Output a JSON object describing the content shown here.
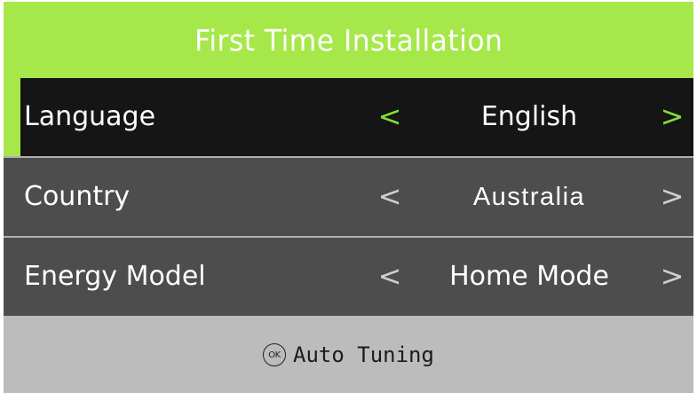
{
  "header": {
    "title": "First Time Installation"
  },
  "rows": [
    {
      "label": "Language",
      "value": "English",
      "left_arrow": "<",
      "right_arrow": ">",
      "focused": true
    },
    {
      "label": "Country",
      "value": "Australia",
      "left_arrow": "<",
      "right_arrow": ">",
      "focused": false
    },
    {
      "label": "Energy Model",
      "value": "Home Mode",
      "left_arrow": "<",
      "right_arrow": ">",
      "focused": false
    }
  ],
  "footer": {
    "ok_icon_text": "OK",
    "label": "Auto Tuning"
  },
  "colors": {
    "accent": "#a6e84a",
    "focused_row": "#151515",
    "row": "#4d4d4d",
    "footer": "#bcbcbc"
  }
}
